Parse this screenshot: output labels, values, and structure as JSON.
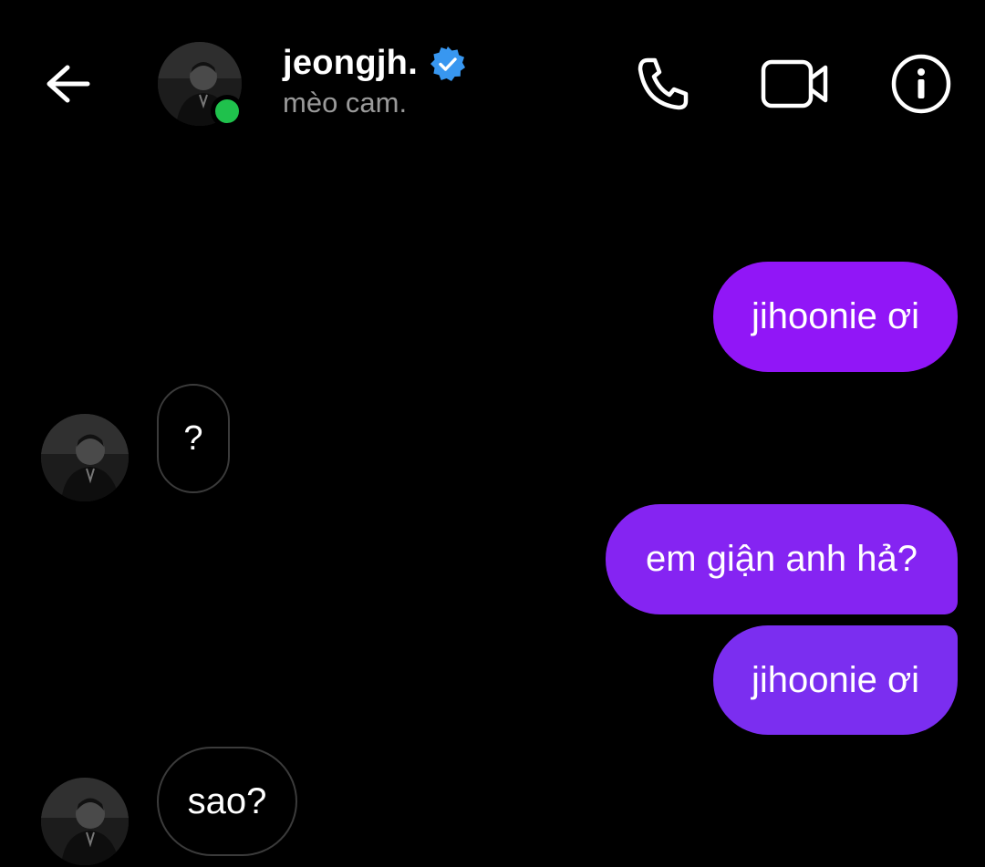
{
  "header": {
    "username": "jeongjh.",
    "subtitle": "mèo cam.",
    "verified": true,
    "online": true,
    "icons": {
      "back": "arrow-left-icon",
      "call": "phone-icon",
      "video": "video-camera-icon",
      "info": "info-icon",
      "verified": "verified-badge-icon"
    }
  },
  "messages": [
    {
      "from": "me",
      "text": "jihoonie ơi"
    },
    {
      "from": "them",
      "text": "?"
    },
    {
      "from": "me",
      "text": "em giận anh hả?"
    },
    {
      "from": "me",
      "text": "jihoonie ơi"
    },
    {
      "from": "them",
      "text": "sao?"
    }
  ],
  "colors": {
    "background": "#000000",
    "sent_bubble_top": "#9116f7",
    "sent_bubble_bottom": "#7b2ef0",
    "received_border": "#3b3b3b",
    "online": "#1fc14c",
    "verified": "#3897f0",
    "subtitle": "#9a9a9a"
  }
}
